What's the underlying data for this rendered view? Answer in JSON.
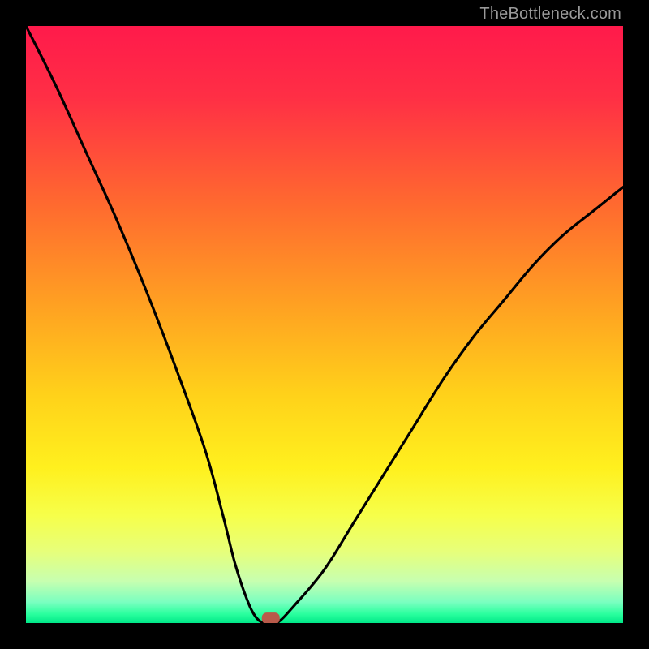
{
  "watermark": "TheBottleneck.com",
  "chart_data": {
    "type": "line",
    "title": "",
    "xlabel": "",
    "ylabel": "",
    "xlim": [
      0,
      100
    ],
    "ylim": [
      0,
      100
    ],
    "series": [
      {
        "name": "curve",
        "x": [
          0,
          5,
          10,
          15,
          20,
          25,
          30,
          33,
          35,
          37,
          38.5,
          40,
          42,
          45,
          50,
          55,
          60,
          65,
          70,
          75,
          80,
          85,
          90,
          95,
          100
        ],
        "values": [
          100,
          90,
          79,
          68,
          56,
          43,
          29,
          18,
          10,
          4,
          1,
          0,
          0,
          3,
          9,
          17,
          25,
          33,
          41,
          48,
          54,
          60,
          65,
          69,
          73
        ]
      }
    ],
    "marker": {
      "x": 41,
      "y": 0.8
    },
    "gradient_stops": [
      {
        "offset": 0.0,
        "color": "#ff1a4b"
      },
      {
        "offset": 0.12,
        "color": "#ff2f45"
      },
      {
        "offset": 0.3,
        "color": "#ff6a2f"
      },
      {
        "offset": 0.48,
        "color": "#ffa521"
      },
      {
        "offset": 0.62,
        "color": "#ffd21a"
      },
      {
        "offset": 0.74,
        "color": "#fff01e"
      },
      {
        "offset": 0.82,
        "color": "#f6ff4a"
      },
      {
        "offset": 0.88,
        "color": "#e7ff7a"
      },
      {
        "offset": 0.93,
        "color": "#c7ffb0"
      },
      {
        "offset": 0.965,
        "color": "#7affc0"
      },
      {
        "offset": 0.985,
        "color": "#2aff9e"
      },
      {
        "offset": 1.0,
        "color": "#00e888"
      }
    ]
  }
}
